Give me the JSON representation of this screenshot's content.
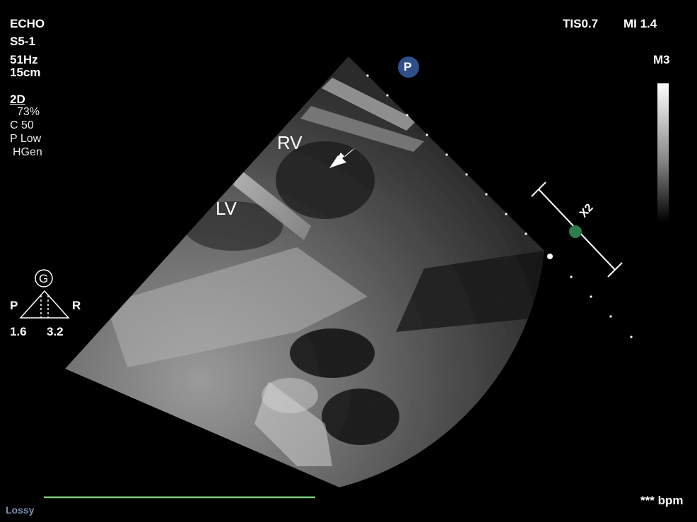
{
  "header": {
    "mode": "ECHO",
    "probe": "S5-1",
    "frame_rate": "51Hz",
    "depth": "15cm",
    "tis": "TIS0.7",
    "mi": "MI 1.4"
  },
  "settings": {
    "mode_2d": "2D",
    "gain": "73%",
    "compression": "C 50",
    "power": "P Low",
    "harmonic": "HGen"
  },
  "colormap": {
    "label": "M3"
  },
  "position_indicator": {
    "letter": "P"
  },
  "orientation": {
    "letter": "G",
    "left": "P",
    "right": "R",
    "left_value": "1.6",
    "right_value": "3.2"
  },
  "zoom_caliper": {
    "label": "X2",
    "dot_color": "#2e7d4f"
  },
  "annotations": {
    "rv": "RV",
    "lv": "LV"
  },
  "footer": {
    "compression_note": "Lossy",
    "heart_rate": "*** bpm",
    "ecg_color": "#7fc97f"
  }
}
